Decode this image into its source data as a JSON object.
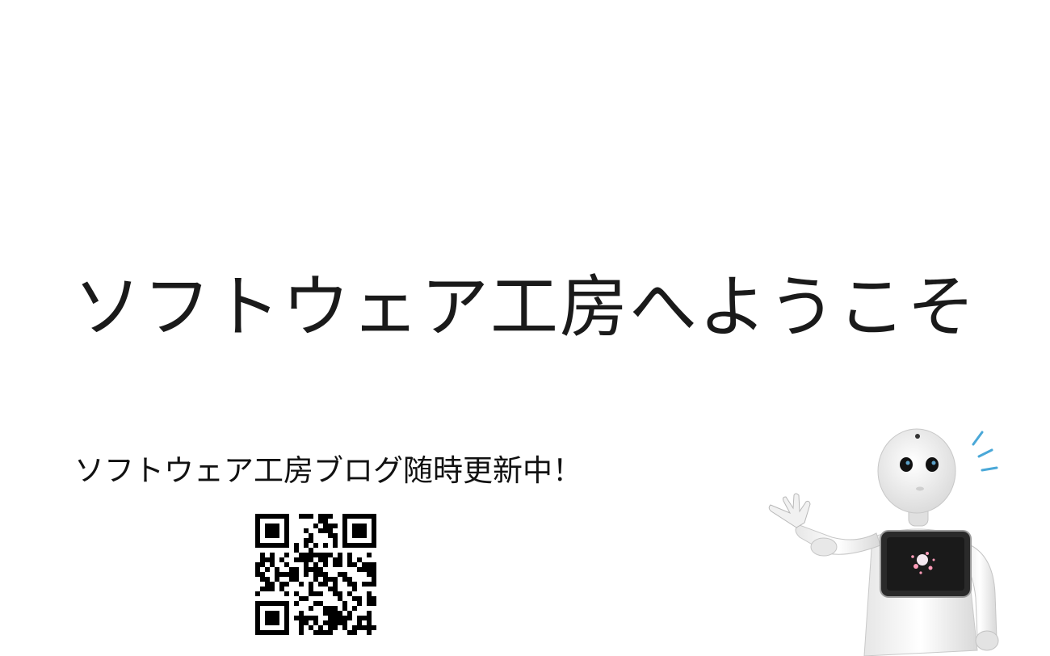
{
  "slide": {
    "title": "ソフトウェア工房へようこそ",
    "blog_notice": "ソフトウェア工房ブログ随時更新中！"
  },
  "images": {
    "qr_code": "qr-code-icon",
    "robot": "humanoid-robot-illustration"
  },
  "colors": {
    "background": "#ffffff",
    "text": "#111111",
    "accent_lines": "#4aa8d8",
    "tablet_screen": "#1a1a1a"
  }
}
